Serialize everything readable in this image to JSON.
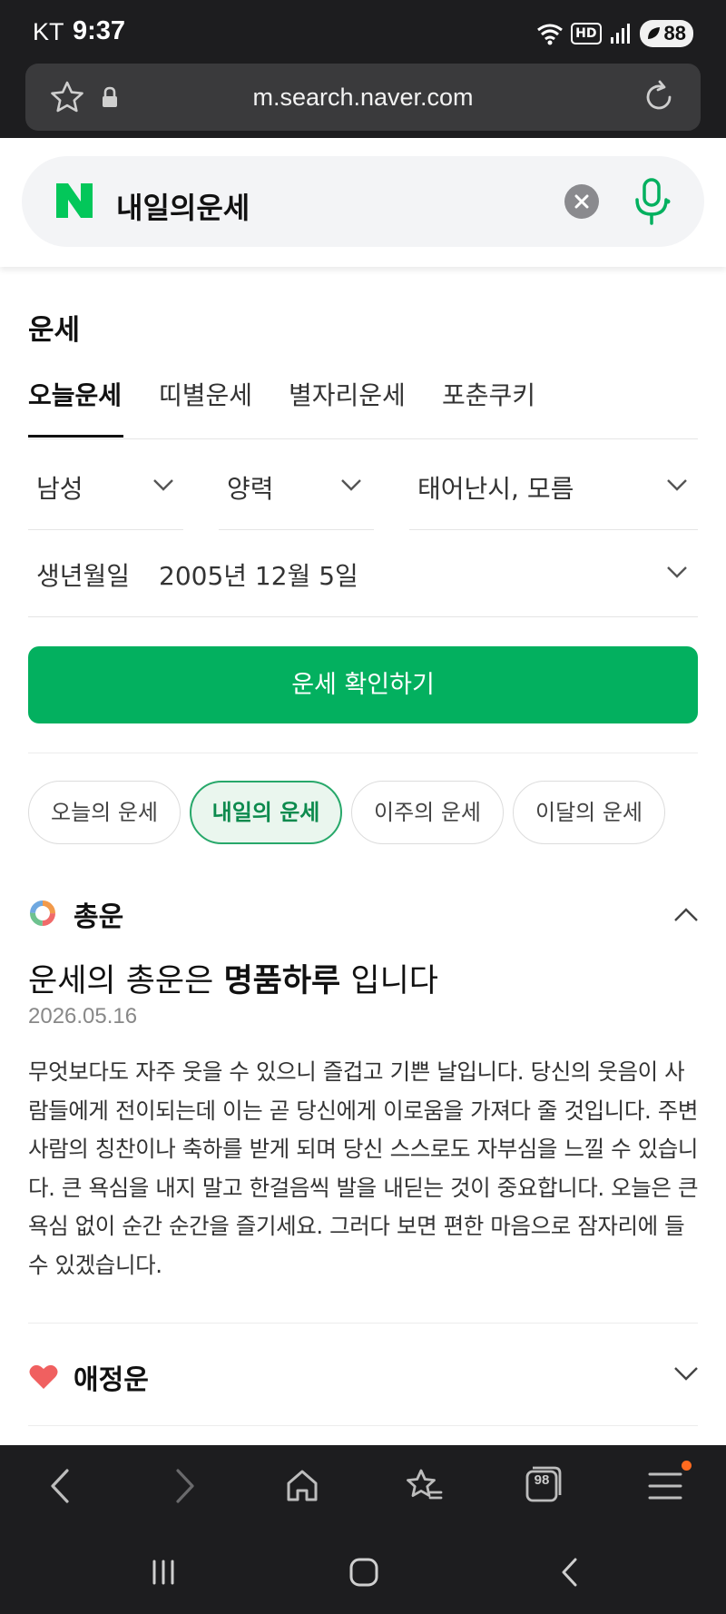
{
  "status_bar": {
    "carrier": "KT",
    "time": "9:37",
    "hd_label": "HD",
    "battery": "88"
  },
  "browser": {
    "url": "m.search.naver.com",
    "toolbar": {
      "tabs_count": "98"
    }
  },
  "search": {
    "logo": "N",
    "query": "내일의운세"
  },
  "fortune": {
    "section_title": "운세",
    "tabs": [
      {
        "label": "오늘운세",
        "active": true
      },
      {
        "label": "띠별운세",
        "active": false
      },
      {
        "label": "별자리운세",
        "active": false
      },
      {
        "label": "포춘쿠키",
        "active": false
      }
    ],
    "gender": "남성",
    "calendar": "양력",
    "birth_time": "태어난시, 모름",
    "birthdate_label": "생년월일",
    "birthdate_value": "2005년 12월 5일",
    "confirm_button": "운세 확인하기",
    "period_chips": [
      {
        "label": "오늘의 운세",
        "active": false
      },
      {
        "label": "내일의 운세",
        "active": true
      },
      {
        "label": "이주의 운세",
        "active": false
      },
      {
        "label": "이달의 운세",
        "active": false
      }
    ],
    "summary": {
      "title": "총운",
      "headline_prefix": "운세의 총운은 ",
      "headline_bold": "명품하루",
      "headline_suffix": " 입니다",
      "date": "2026.05.16",
      "body": "무엇보다도 자주 웃을 수 있으니 즐겁고 기쁜 날입니다. 당신의 웃음이 사람들에게 전이되는데 이는 곧 당신에게 이로움을 가져다 줄 것입니다. 주변 사람의 칭찬이나 축하를 받게 되며 당신 스스로도 자부심을 느낄 수 있습니다. 큰 욕심을 내지 말고 한걸음씩 발을 내딛는 것이 중요합니다. 오늘은 큰 욕심 없이 순간 순간을 즐기세요. 그러다 보면 편한 마음으로 잠자리에 들 수 있겠습니다."
    },
    "love": {
      "title": "애정운"
    }
  },
  "colors": {
    "naver_green": "#03b05f",
    "active_chip_border": "#27a86a",
    "active_chip_bg": "#eaf6ee",
    "dark_chrome": "#1d1d1f",
    "heart": "#f06060",
    "notification_dot": "#ff6a1f"
  },
  "icons": [
    "star-icon",
    "lock-icon",
    "reload-icon",
    "clear-icon",
    "mic-icon",
    "chevron-down-icon",
    "chevron-up-icon",
    "pie-icon",
    "heart-icon",
    "back-icon",
    "forward-icon",
    "home-icon",
    "bookmarks-icon",
    "tabs-icon",
    "menu-icon"
  ]
}
